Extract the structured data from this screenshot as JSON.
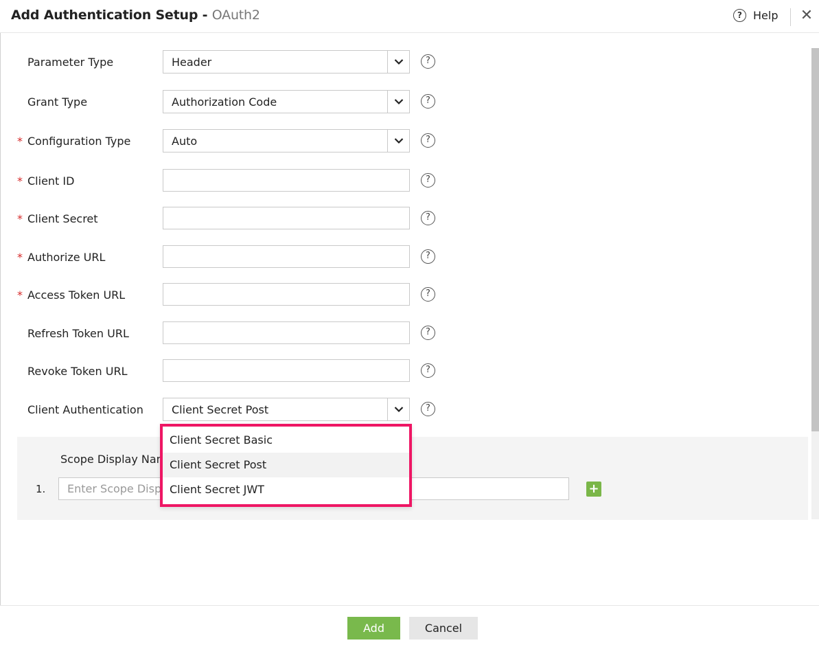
{
  "header": {
    "title": "Add Authentication Setup",
    "separator": " - ",
    "subtitle": "OAuth2",
    "help_label": "Help",
    "close_glyph": "✕"
  },
  "icons": {
    "help": "question-circle-icon",
    "close": "close-icon",
    "chevron": "chevron-down-icon",
    "add": "plus-icon"
  },
  "required_mark": "*",
  "help_glyph": "?",
  "fields": [
    {
      "label": "Parameter Type",
      "required": false,
      "type": "select",
      "value": "Header"
    },
    {
      "label": "Grant Type",
      "required": false,
      "type": "select",
      "value": "Authorization Code"
    },
    {
      "label": "Configuration Type",
      "required": true,
      "type": "select",
      "value": "Auto"
    },
    {
      "label": "Client ID",
      "required": true,
      "type": "text",
      "value": ""
    },
    {
      "label": "Client Secret",
      "required": true,
      "type": "text",
      "value": ""
    },
    {
      "label": "Authorize URL",
      "required": true,
      "type": "text",
      "value": ""
    },
    {
      "label": "Access Token URL",
      "required": true,
      "type": "text",
      "value": ""
    },
    {
      "label": "Refresh Token URL",
      "required": false,
      "type": "text",
      "value": ""
    },
    {
      "label": "Revoke Token URL",
      "required": false,
      "type": "text",
      "value": ""
    },
    {
      "label": "Client Authentication",
      "required": false,
      "type": "select",
      "value": "Client Secret Post"
    }
  ],
  "dropdown": {
    "options": [
      "Client Secret Basic",
      "Client Secret Post",
      "Client Secret JWT"
    ],
    "highlighted": "Client Secret Post",
    "highlight_color": "#ee1664"
  },
  "scope": {
    "label": "Scope Display Name",
    "row_number": "1.",
    "placeholder": "Enter Scope Display Name",
    "add_glyph": "+"
  },
  "footer": {
    "add_label": "Add",
    "cancel_label": "Cancel"
  },
  "colors": {
    "primary_button": "#79b94c",
    "required": "#d62b2b"
  }
}
